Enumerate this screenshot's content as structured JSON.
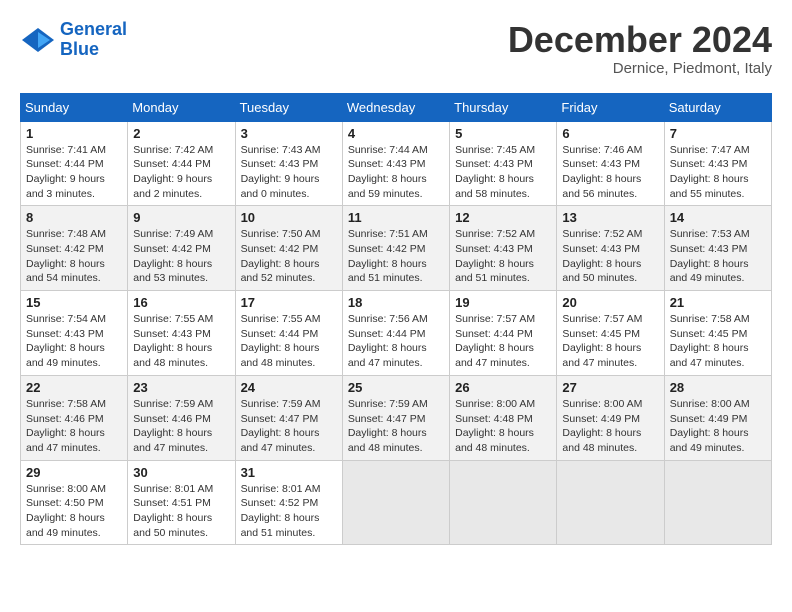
{
  "header": {
    "logo_line1": "General",
    "logo_line2": "Blue",
    "month": "December 2024",
    "location": "Dernice, Piedmont, Italy"
  },
  "days_of_week": [
    "Sunday",
    "Monday",
    "Tuesday",
    "Wednesday",
    "Thursday",
    "Friday",
    "Saturday"
  ],
  "weeks": [
    [
      {
        "day": "1",
        "lines": [
          "Sunrise: 7:41 AM",
          "Sunset: 4:44 PM",
          "Daylight: 9 hours",
          "and 3 minutes."
        ]
      },
      {
        "day": "2",
        "lines": [
          "Sunrise: 7:42 AM",
          "Sunset: 4:44 PM",
          "Daylight: 9 hours",
          "and 2 minutes."
        ]
      },
      {
        "day": "3",
        "lines": [
          "Sunrise: 7:43 AM",
          "Sunset: 4:43 PM",
          "Daylight: 9 hours",
          "and 0 minutes."
        ]
      },
      {
        "day": "4",
        "lines": [
          "Sunrise: 7:44 AM",
          "Sunset: 4:43 PM",
          "Daylight: 8 hours",
          "and 59 minutes."
        ]
      },
      {
        "day": "5",
        "lines": [
          "Sunrise: 7:45 AM",
          "Sunset: 4:43 PM",
          "Daylight: 8 hours",
          "and 58 minutes."
        ]
      },
      {
        "day": "6",
        "lines": [
          "Sunrise: 7:46 AM",
          "Sunset: 4:43 PM",
          "Daylight: 8 hours",
          "and 56 minutes."
        ]
      },
      {
        "day": "7",
        "lines": [
          "Sunrise: 7:47 AM",
          "Sunset: 4:43 PM",
          "Daylight: 8 hours",
          "and 55 minutes."
        ]
      }
    ],
    [
      {
        "day": "8",
        "lines": [
          "Sunrise: 7:48 AM",
          "Sunset: 4:42 PM",
          "Daylight: 8 hours",
          "and 54 minutes."
        ]
      },
      {
        "day": "9",
        "lines": [
          "Sunrise: 7:49 AM",
          "Sunset: 4:42 PM",
          "Daylight: 8 hours",
          "and 53 minutes."
        ]
      },
      {
        "day": "10",
        "lines": [
          "Sunrise: 7:50 AM",
          "Sunset: 4:42 PM",
          "Daylight: 8 hours",
          "and 52 minutes."
        ]
      },
      {
        "day": "11",
        "lines": [
          "Sunrise: 7:51 AM",
          "Sunset: 4:42 PM",
          "Daylight: 8 hours",
          "and 51 minutes."
        ]
      },
      {
        "day": "12",
        "lines": [
          "Sunrise: 7:52 AM",
          "Sunset: 4:43 PM",
          "Daylight: 8 hours",
          "and 51 minutes."
        ]
      },
      {
        "day": "13",
        "lines": [
          "Sunrise: 7:52 AM",
          "Sunset: 4:43 PM",
          "Daylight: 8 hours",
          "and 50 minutes."
        ]
      },
      {
        "day": "14",
        "lines": [
          "Sunrise: 7:53 AM",
          "Sunset: 4:43 PM",
          "Daylight: 8 hours",
          "and 49 minutes."
        ]
      }
    ],
    [
      {
        "day": "15",
        "lines": [
          "Sunrise: 7:54 AM",
          "Sunset: 4:43 PM",
          "Daylight: 8 hours",
          "and 49 minutes."
        ]
      },
      {
        "day": "16",
        "lines": [
          "Sunrise: 7:55 AM",
          "Sunset: 4:43 PM",
          "Daylight: 8 hours",
          "and 48 minutes."
        ]
      },
      {
        "day": "17",
        "lines": [
          "Sunrise: 7:55 AM",
          "Sunset: 4:44 PM",
          "Daylight: 8 hours",
          "and 48 minutes."
        ]
      },
      {
        "day": "18",
        "lines": [
          "Sunrise: 7:56 AM",
          "Sunset: 4:44 PM",
          "Daylight: 8 hours",
          "and 47 minutes."
        ]
      },
      {
        "day": "19",
        "lines": [
          "Sunrise: 7:57 AM",
          "Sunset: 4:44 PM",
          "Daylight: 8 hours",
          "and 47 minutes."
        ]
      },
      {
        "day": "20",
        "lines": [
          "Sunrise: 7:57 AM",
          "Sunset: 4:45 PM",
          "Daylight: 8 hours",
          "and 47 minutes."
        ]
      },
      {
        "day": "21",
        "lines": [
          "Sunrise: 7:58 AM",
          "Sunset: 4:45 PM",
          "Daylight: 8 hours",
          "and 47 minutes."
        ]
      }
    ],
    [
      {
        "day": "22",
        "lines": [
          "Sunrise: 7:58 AM",
          "Sunset: 4:46 PM",
          "Daylight: 8 hours",
          "and 47 minutes."
        ]
      },
      {
        "day": "23",
        "lines": [
          "Sunrise: 7:59 AM",
          "Sunset: 4:46 PM",
          "Daylight: 8 hours",
          "and 47 minutes."
        ]
      },
      {
        "day": "24",
        "lines": [
          "Sunrise: 7:59 AM",
          "Sunset: 4:47 PM",
          "Daylight: 8 hours",
          "and 47 minutes."
        ]
      },
      {
        "day": "25",
        "lines": [
          "Sunrise: 7:59 AM",
          "Sunset: 4:47 PM",
          "Daylight: 8 hours",
          "and 48 minutes."
        ]
      },
      {
        "day": "26",
        "lines": [
          "Sunrise: 8:00 AM",
          "Sunset: 4:48 PM",
          "Daylight: 8 hours",
          "and 48 minutes."
        ]
      },
      {
        "day": "27",
        "lines": [
          "Sunrise: 8:00 AM",
          "Sunset: 4:49 PM",
          "Daylight: 8 hours",
          "and 48 minutes."
        ]
      },
      {
        "day": "28",
        "lines": [
          "Sunrise: 8:00 AM",
          "Sunset: 4:49 PM",
          "Daylight: 8 hours",
          "and 49 minutes."
        ]
      }
    ],
    [
      {
        "day": "29",
        "lines": [
          "Sunrise: 8:00 AM",
          "Sunset: 4:50 PM",
          "Daylight: 8 hours",
          "and 49 minutes."
        ]
      },
      {
        "day": "30",
        "lines": [
          "Sunrise: 8:01 AM",
          "Sunset: 4:51 PM",
          "Daylight: 8 hours",
          "and 50 minutes."
        ]
      },
      {
        "day": "31",
        "lines": [
          "Sunrise: 8:01 AM",
          "Sunset: 4:52 PM",
          "Daylight: 8 hours",
          "and 51 minutes."
        ]
      },
      null,
      null,
      null,
      null
    ]
  ]
}
